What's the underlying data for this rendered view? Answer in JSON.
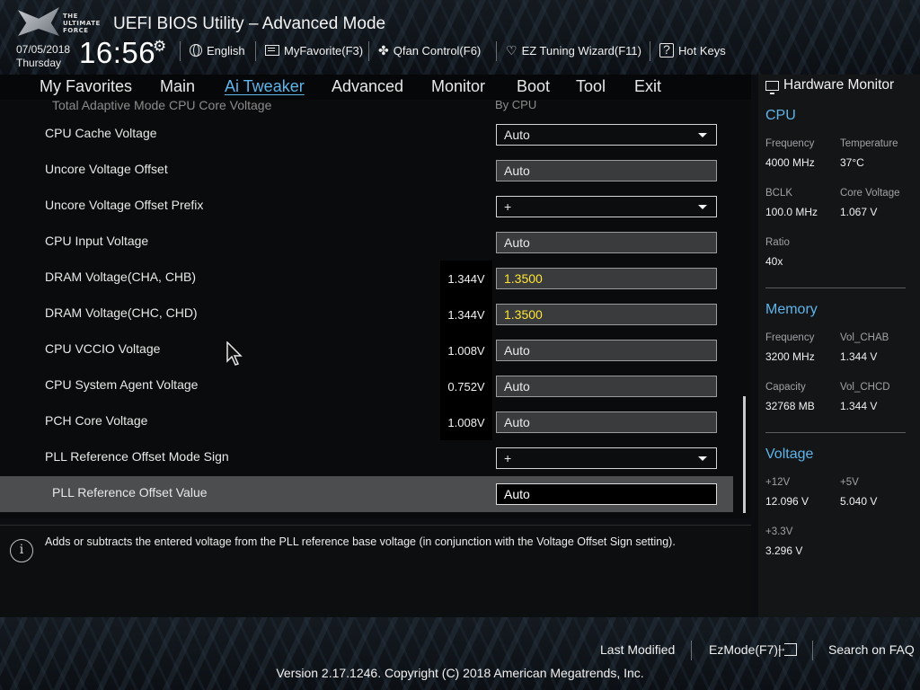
{
  "app": {
    "logo_text": "THE ULTIMATE FORCE",
    "title": "UEFI BIOS Utility – Advanced Mode",
    "date": "07/05/2018",
    "day": "Thursday",
    "time": "16:56"
  },
  "hotkeys": [
    {
      "label": "English",
      "icon": "globe-icon"
    },
    {
      "label": "MyFavorite(F3)",
      "icon": "favorite-icon"
    },
    {
      "label": "Qfan Control(F6)",
      "icon": "fan-icon"
    },
    {
      "label": "EZ Tuning Wizard(F11)",
      "icon": "lightbulb-icon"
    },
    {
      "label": "Hot Keys",
      "icon": "question-icon"
    }
  ],
  "tabs": [
    {
      "label": "My Favorites"
    },
    {
      "label": "Main"
    },
    {
      "label": "Ai Tweaker",
      "active": true
    },
    {
      "label": "Advanced"
    },
    {
      "label": "Monitor"
    },
    {
      "label": "Boot"
    },
    {
      "label": "Tool"
    },
    {
      "label": "Exit"
    }
  ],
  "settings": {
    "partial": {
      "label": "Total Adaptive Mode CPU Core Voltage",
      "value": "By CPU"
    },
    "rows": [
      {
        "label": "CPU Cache Voltage",
        "value": "Auto",
        "type": "dropdown"
      },
      {
        "label": "Uncore Voltage Offset",
        "value": "Auto",
        "type": "field"
      },
      {
        "label": "Uncore Voltage Offset Prefix",
        "value": "+",
        "type": "dropdown"
      },
      {
        "label": "CPU Input Voltage",
        "value": "Auto",
        "type": "field"
      },
      {
        "label": "DRAM Voltage(CHA, CHB)",
        "reading": "1.344V",
        "value": "1.3500",
        "type": "field",
        "highlight": true
      },
      {
        "label": "DRAM Voltage(CHC, CHD)",
        "reading": "1.344V",
        "value": "1.3500",
        "type": "field",
        "highlight": true
      },
      {
        "label": "CPU VCCIO Voltage",
        "reading": "1.008V",
        "value": "Auto",
        "type": "field"
      },
      {
        "label": "CPU System Agent Voltage",
        "reading": "0.752V",
        "value": "Auto",
        "type": "field"
      },
      {
        "label": "PCH Core Voltage",
        "reading": "1.008V",
        "value": "Auto",
        "type": "field"
      },
      {
        "label": "PLL Reference Offset Mode Sign",
        "value": "+",
        "type": "dropdown"
      },
      {
        "label": "PLL Reference Offset Value",
        "value": "Auto",
        "type": "field",
        "selected": true
      }
    ]
  },
  "help": {
    "icon": "info-icon",
    "text": "Adds or subtracts the entered voltage from the PLL reference base voltage (in conjunction with the Voltage Offset Sign setting)."
  },
  "hardware_monitor": {
    "title": "Hardware Monitor",
    "cpu": {
      "heading": "CPU",
      "frequency_label": "Frequency",
      "frequency": "4000 MHz",
      "temperature_label": "Temperature",
      "temperature": "37°C",
      "bclk_label": "BCLK",
      "bclk": "100.0 MHz",
      "core_voltage_label": "Core Voltage",
      "core_voltage": "1.067 V",
      "ratio_label": "Ratio",
      "ratio": "40x"
    },
    "memory": {
      "heading": "Memory",
      "frequency_label": "Frequency",
      "frequency": "3200 MHz",
      "vol_chab_label": "Vol_CHAB",
      "vol_chab": "1.344 V",
      "capacity_label": "Capacity",
      "capacity": "32768 MB",
      "vol_chcd_label": "Vol_CHCD",
      "vol_chcd": "1.344 V"
    },
    "voltage": {
      "heading": "Voltage",
      "v12_label": "+12V",
      "v12": "12.096 V",
      "v5_label": "+5V",
      "v5": "5.040 V",
      "v33_label": "+3.3V",
      "v33": "3.296 V"
    }
  },
  "footer": {
    "last_modified": "Last Modified",
    "ezmode": "EzMode(F7)|",
    "search_faq": "Search on FAQ",
    "version": "Version 2.17.1246. Copyright (C) 2018 American Megatrends, Inc."
  },
  "colors": {
    "accent": "#5fb4ea",
    "highlight_value": "#ffe533",
    "selected_row": "#4c4d4f"
  }
}
